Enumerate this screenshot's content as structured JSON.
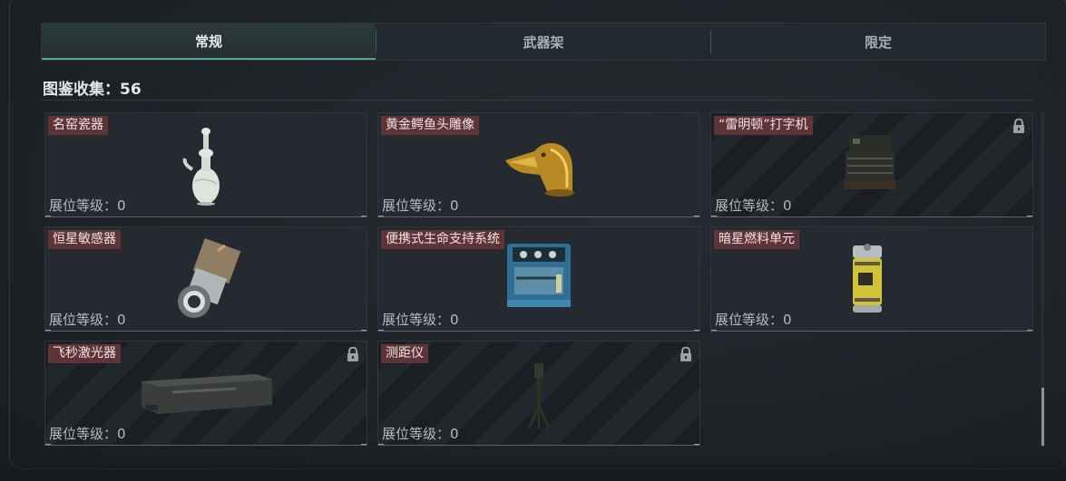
{
  "tabs": [
    {
      "label": "常规",
      "active": true
    },
    {
      "label": "武器架",
      "active": false
    },
    {
      "label": "限定",
      "active": false
    }
  ],
  "collection": {
    "label": "图鉴收集：56"
  },
  "items": [
    {
      "name": "名窑瓷器",
      "level": "展位等级：0",
      "locked": false,
      "icon": "porcelain-vase-icon"
    },
    {
      "name": "黄金鳄鱼头雕像",
      "level": "展位等级：0",
      "locked": false,
      "icon": "golden-crocodile-head-icon"
    },
    {
      "name": "“雷明顿”打字机",
      "level": "展位等级：0",
      "locked": true,
      "icon": "typewriter-icon"
    },
    {
      "name": "恒星敏感器",
      "level": "展位等级：0",
      "locked": false,
      "icon": "star-sensor-icon"
    },
    {
      "name": "便携式生命支持系统",
      "level": "展位等级：0",
      "locked": false,
      "icon": "life-support-system-icon"
    },
    {
      "name": "暗星燃料单元",
      "level": "展位等级：0",
      "locked": false,
      "icon": "fuel-cell-icon"
    },
    {
      "name": "飞秒激光器",
      "level": "展位等级：0",
      "locked": true,
      "icon": "femtosecond-laser-icon"
    },
    {
      "name": "测距仪",
      "level": "展位等级：0",
      "locked": true,
      "icon": "rangefinder-icon"
    }
  ],
  "colors": {
    "accent": "#4fa993",
    "name_tag": "#5e3438",
    "background": "#1e2328"
  }
}
